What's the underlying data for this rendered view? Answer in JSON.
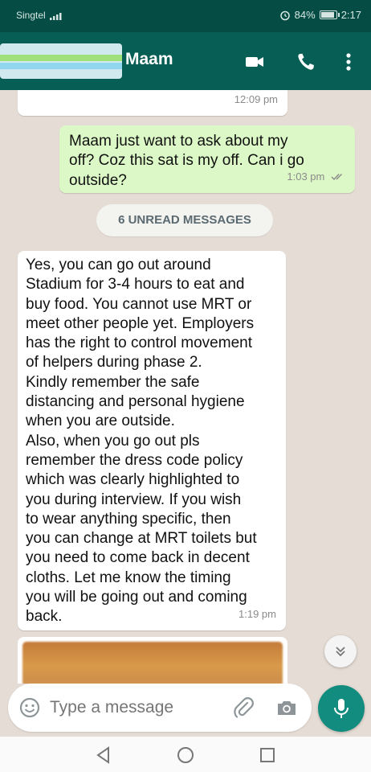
{
  "status_bar": {
    "carrier": "Singtel",
    "battery": "84%",
    "time": "2:17"
  },
  "header": {
    "contact_name": "Maam",
    "icons": [
      "back-icon",
      "video-call-icon",
      "phone-icon",
      "more-options-icon"
    ]
  },
  "messages": [
    {
      "direction": "incoming",
      "text": "",
      "time": "12:09 pm"
    },
    {
      "direction": "outgoing",
      "text": "Maam  just want to ask about my\noff? Coz this sat is my off. Can i go\noutside?",
      "time": "1:03 pm",
      "status": "read"
    },
    {
      "direction": "incoming",
      "text": "Yes, you can go out around\nStadium for 3-4 hours to eat and\nbuy food. You cannot use MRT or\nmeet other people yet. Employers\nhas the right to control movement\nof helpers during phase 2.\nKindly remember the safe\ndistancing and personal hygiene\nwhen you are outside.\nAlso, when you go out pls\nremember the dress code policy\nwhich was clearly highlighted to\nyou during interview. If you wish\nto wear anything specific, then\nyou can change at MRT toilets but\nyou need to come back in decent\ncloths. Let me know the timing\nyou will be going out and coming\nback.",
      "time": "1:19 pm"
    }
  ],
  "unread_banner": "6 UNREAD MESSAGES",
  "composer": {
    "placeholder": "Type a message",
    "icons": [
      "emoji-icon",
      "attach-icon",
      "camera-icon",
      "mic-icon"
    ]
  },
  "colors": {
    "app_bar": "#075e54",
    "status_bar": "#054d44",
    "outgoing_bubble": "#dcf8c6",
    "incoming_bubble": "#ffffff",
    "chat_background": "#e5ddd5",
    "accent": "#128c7e"
  }
}
